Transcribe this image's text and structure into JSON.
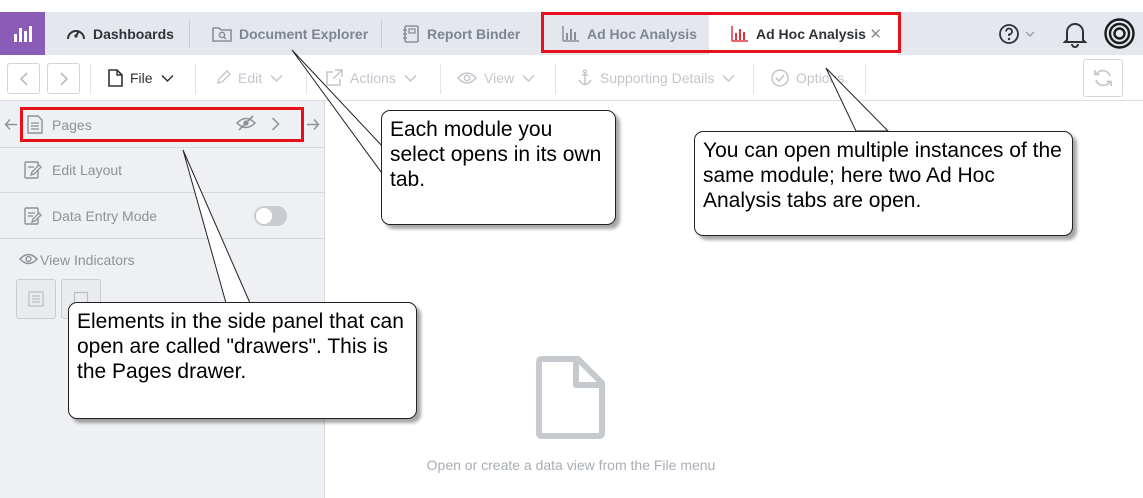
{
  "top_tabs": {
    "dashboards": "Dashboards",
    "document_explorer": "Document Explorer",
    "report_binder": "Report Binder",
    "ad_hoc_1": "Ad Hoc Analysis",
    "ad_hoc_2": "Ad Hoc Analysis",
    "close_glyph": "✕"
  },
  "toolbar": {
    "file": "File",
    "edit": "Edit",
    "actions": "Actions",
    "view": "View",
    "supporting_details": "Supporting Details",
    "options": "Options"
  },
  "side_panel": {
    "pages": "Pages",
    "edit_layout": "Edit Layout",
    "data_entry_mode": "Data Entry Mode",
    "view_indicators": "View Indicators"
  },
  "main": {
    "empty_message": "Open or create a data view from the File menu"
  },
  "callouts": {
    "module_tab": "Each module you select opens in its own tab.",
    "multiple_instances": "You can open multiple instances of the same module; here two Ad Hoc Analysis tabs are open.",
    "drawers": "Elements in the side panel that can open are called \"drawers\". This is the Pages drawer."
  },
  "colors": {
    "brand": "#8b5cb7",
    "highlight": "#e8101a",
    "active_chart_icon": "#e0323a"
  }
}
